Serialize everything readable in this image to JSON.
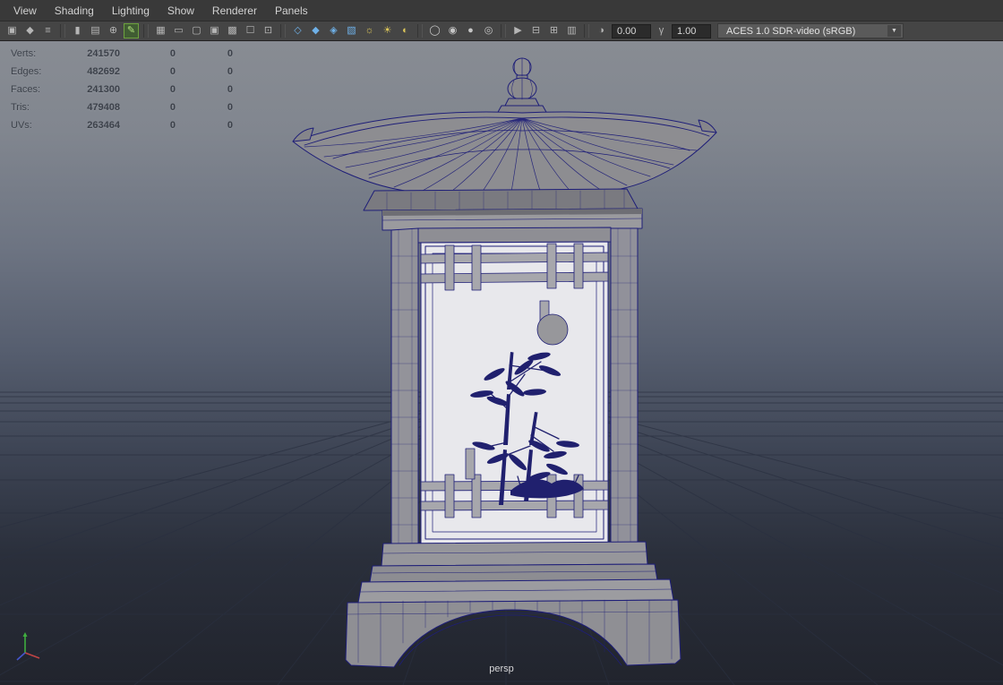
{
  "menus": [
    "View",
    "Shading",
    "Lighting",
    "Show",
    "Renderer",
    "Panels"
  ],
  "toolbar": {
    "icons": [
      {
        "name": "select-camera",
        "glyph": "▣"
      },
      {
        "name": "lock-camera",
        "glyph": "◆"
      },
      {
        "name": "camera-attributes",
        "glyph": "≡"
      },
      {
        "name": "bookmark",
        "glyph": "▮"
      },
      {
        "name": "image-plane",
        "glyph": "▤"
      },
      {
        "name": "two-d-pan-zoom",
        "glyph": "⊕"
      },
      {
        "name": "grease-pencil",
        "glyph": "✎"
      },
      {
        "name": "grid",
        "glyph": "▦"
      },
      {
        "name": "film-gate",
        "glyph": "▭"
      },
      {
        "name": "resolution-gate",
        "glyph": "▢"
      },
      {
        "name": "gate-mask",
        "glyph": "▣"
      },
      {
        "name": "field-chart",
        "glyph": "▩"
      },
      {
        "name": "safe-action",
        "glyph": "☐"
      },
      {
        "name": "safe-title",
        "glyph": "⊡"
      },
      {
        "name": "wireframe-mode",
        "glyph": "◇"
      },
      {
        "name": "shaded-mode",
        "glyph": "◆"
      },
      {
        "name": "textured-mode",
        "glyph": "◈"
      },
      {
        "name": "material-override",
        "glyph": "▧"
      },
      {
        "name": "default-lighting",
        "glyph": "☼"
      },
      {
        "name": "all-lights",
        "glyph": "☀"
      },
      {
        "name": "shadows",
        "glyph": "◐"
      },
      {
        "name": "ambient-occlusion",
        "glyph": "◯"
      },
      {
        "name": "motion-blur",
        "glyph": "◉"
      },
      {
        "name": "default-material",
        "glyph": "●"
      },
      {
        "name": "xray",
        "glyph": "◎"
      },
      {
        "name": "isolate-select",
        "glyph": "▶"
      },
      {
        "name": "pane-single",
        "glyph": "⊟"
      },
      {
        "name": "pane-quad",
        "glyph": "⊞"
      },
      {
        "name": "outliner-panel",
        "glyph": "▥"
      },
      {
        "name": "exposure",
        "glyph": "◑"
      },
      {
        "name": "gamma",
        "glyph": "γ"
      }
    ],
    "exposure_value": "0.00",
    "gamma_value": "1.00",
    "view_transform": "ACES 1.0 SDR-video (sRGB)",
    "dropdown_arrow": "▼"
  },
  "hud": {
    "rows": [
      {
        "label": "Verts:",
        "total": "241570",
        "col2": "0",
        "col3": "0"
      },
      {
        "label": "Edges:",
        "total": "482692",
        "col2": "0",
        "col3": "0"
      },
      {
        "label": "Faces:",
        "total": "241300",
        "col2": "0",
        "col3": "0"
      },
      {
        "label": "Tris:",
        "total": "479408",
        "col2": "0",
        "col3": "0"
      },
      {
        "label": "UVs:",
        "total": "263464",
        "col2": "0",
        "col3": "0"
      }
    ]
  },
  "viewport": {
    "camera_label": "persp"
  },
  "colors": {
    "wireframe_navy": "#1e1e78",
    "bamboo_navy": "#20206e",
    "model_gray": "#929296",
    "panel_white": "#e8e8ec",
    "bg_top": "#888c93",
    "bg_bottom": "#21242d",
    "active_tool_green": "#aee07a",
    "shading_icon_blue": "#6fb1e8",
    "light_icon_yellow": "#ddc75a",
    "menubar_bg": "#393939",
    "toolbar_bg": "#454545"
  }
}
